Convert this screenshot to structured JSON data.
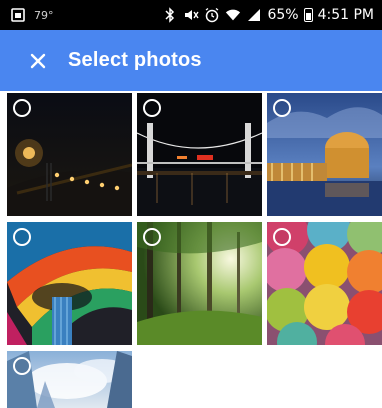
{
  "status_bar": {
    "temperature": "79°",
    "battery_percent": "65%",
    "time": "4:51 PM",
    "icons": [
      "gallery-notification-icon",
      "bluetooth-icon",
      "mute-icon",
      "alarm-icon",
      "wifi-icon",
      "signal-icon",
      "battery-icon"
    ]
  },
  "app_bar": {
    "title": "Select photos",
    "color": "#4a86f0",
    "close_icon": "close-icon"
  },
  "photos": [
    {
      "subject": "bridge-lights-night",
      "selected": false
    },
    {
      "subject": "rainbow-bridge-night",
      "selected": false
    },
    {
      "subject": "palace-of-fine-arts-dusk",
      "selected": false
    },
    {
      "subject": "colorful-dome-ceiling",
      "selected": false
    },
    {
      "subject": "sunlit-forest",
      "selected": false
    },
    {
      "subject": "yarn-balls",
      "selected": false
    },
    {
      "subject": "skyscrapers-clouds",
      "selected": false
    }
  ]
}
